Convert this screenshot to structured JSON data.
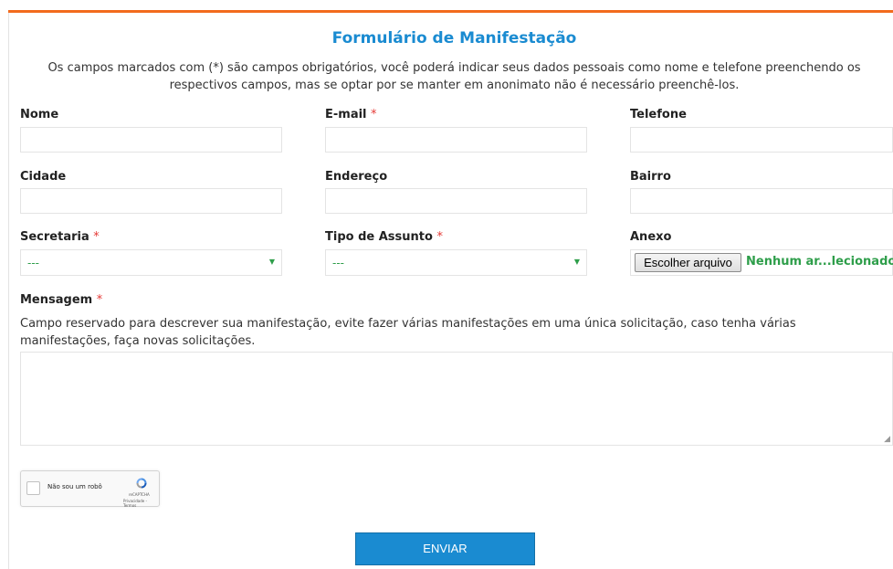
{
  "form": {
    "title": "Formulário de Manifestação",
    "intro": "Os campos marcados com (*) são campos obrigatórios, você poderá indicar seus dados pessoais como nome e telefone preenchendo os respectivos campos, mas se optar por se manter em anonimato não é necessário preenchê-los.",
    "required_mark": "*"
  },
  "fields": {
    "nome": {
      "label": "Nome",
      "value": ""
    },
    "email": {
      "label": "E-mail",
      "value": ""
    },
    "telefone": {
      "label": "Telefone",
      "value": ""
    },
    "cidade": {
      "label": "Cidade",
      "value": ""
    },
    "endereco": {
      "label": "Endereço",
      "value": ""
    },
    "bairro": {
      "label": "Bairro",
      "value": ""
    },
    "secretaria": {
      "label": "Secretaria",
      "selected": "---"
    },
    "tipo_assunto": {
      "label": "Tipo de Assunto",
      "selected": "---"
    },
    "anexo": {
      "label": "Anexo",
      "button": "Escolher arquivo",
      "status": "Nenhum ar...lecionado"
    },
    "mensagem": {
      "label": "Mensagem",
      "help": "Campo reservado para descrever sua manifestação, evite fazer várias manifestações em uma única solicitação, caso tenha várias manifestações, faça novas solicitações.",
      "value": ""
    }
  },
  "captcha": {
    "label": "Não sou um robô",
    "brand": "reCAPTCHA",
    "links": "Privacidade - Termos",
    "icon": "recaptcha-icon"
  },
  "submit_label": "ENVIAR",
  "colors": {
    "accent": "#1a8bd1",
    "top_bar": "#f26b1d",
    "required": "#e53935",
    "select_text": "#2e9e4a"
  }
}
